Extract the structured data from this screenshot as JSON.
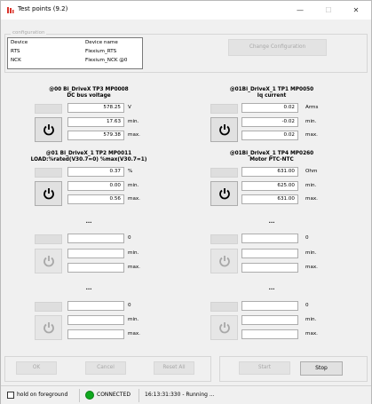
{
  "window": {
    "title": "Test points (9.2)",
    "minimize_glyph": "—",
    "maximize_glyph": "☐",
    "close_glyph": "✕"
  },
  "configuration": {
    "group_label": "configuration",
    "col_device": "Device",
    "col_name": "Device name",
    "rows": [
      {
        "device": "RTS",
        "name": "Flexium_RTS"
      },
      {
        "device": "NCK",
        "name": "Flexium_NCK @0"
      }
    ],
    "change_button": "Change Configuration"
  },
  "panels": {
    "p1": {
      "title1": "@00 Bi_DriveX TP3 MP0008",
      "title2": "DC bus voltage",
      "value": "578.25",
      "unit": "V",
      "min": "17.63",
      "min_label": "min.",
      "max": "579.38",
      "max_label": "max."
    },
    "p2": {
      "title1": "@01Bi_DriveX_1 TP1 MP0050",
      "title2": "Iq current",
      "value": "0.02",
      "unit": "Arms",
      "min": "-0.02",
      "min_label": "min.",
      "max": "0.02",
      "max_label": "max."
    },
    "p3": {
      "title1": "@01 Bi_DriveX_1 TP2 MP0011",
      "title2": "LOAD:%rated(V30.7=0) %max(V30.7=1)",
      "value": "0.37",
      "unit": "%",
      "min": "0.00",
      "min_label": "min.",
      "max": "0.56",
      "max_label": "max."
    },
    "p4": {
      "title1": "@01Bi_DriveX_1 TP4 MP0260",
      "title2": "Motor PTC-NTC",
      "value": "631.00",
      "unit": "Ohm",
      "min": "625.00",
      "min_label": "min.",
      "max": "631.00",
      "max_label": "max."
    },
    "p5": {
      "title": "...",
      "value": "",
      "unit": "0",
      "min": "",
      "min_label": "min.",
      "max": "",
      "max_label": "max."
    },
    "p6": {
      "title": "...",
      "value": "",
      "unit": "0",
      "min": "",
      "min_label": "min.",
      "max": "",
      "max_label": "max."
    },
    "p7": {
      "title": "...",
      "value": "",
      "unit": "0",
      "min": "",
      "min_label": "min.",
      "max": "",
      "max_label": "max."
    },
    "p8": {
      "title": "...",
      "value": "",
      "unit": "0",
      "min": "",
      "min_label": "min.",
      "max": "",
      "max_label": "max."
    }
  },
  "bottom": {
    "ok_button": "OK",
    "cancel_button": "Cancel",
    "reset_all_button": "Reset All",
    "start_button": "Start",
    "stop_button": "Stop"
  },
  "status_bar": {
    "hold_label": "hold on foreground",
    "hold_checked": false,
    "connection": "CONNECTED",
    "connection_color": "#0fa81e",
    "message": "16:13:31:330 - Running ..."
  },
  "icons": {
    "app": "test-points-app-icon",
    "power": "power-icon"
  },
  "colors": {
    "window_bg": "#f0f0f0",
    "disabled_text": "#a8a8a8"
  }
}
